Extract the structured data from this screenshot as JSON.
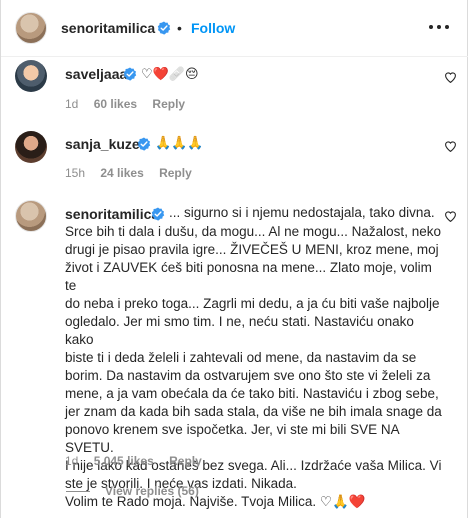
{
  "header": {
    "username": "senoritamilica",
    "separator": "•",
    "follow_label": "Follow"
  },
  "comments": [
    {
      "username": "saveljaaa",
      "text": "♡❤️🩹😔",
      "age": "1d",
      "likes": "60 likes",
      "reply_label": "Reply"
    },
    {
      "username": "sanja_kuzet",
      "text": "🙏🙏🙏",
      "age": "15h",
      "likes": "24 likes",
      "reply_label": "Reply"
    },
    {
      "username": "senoritamilica",
      "text_first": "... sigurno si i njemu nedostajala, tako divna.",
      "text_lines": [
        "Srce bih ti dala i dušu, da mogu... Al ne mogu... Nažalost, neko",
        "drugi je pisao pravila igre... ŽIVEČEŠ U MENI, kroz mene, moj",
        "život i ZAUVEK ćeš biti ponosna na mene... Zlato moje, volim te",
        "do neba i preko toga... Zagrli mi dedu, a ja ću biti vaše najbolje",
        "ogledalo. Jer mi smo tim. I ne, neću stati. Nastaviću onako kako",
        "biste ti i deda želeli i zahtevali od mene, da nastavim da se",
        "borim. Da nastavim da ostvarujem sve ono što ste vi želeli za",
        "mene, a ja vam obećala da će tako biti. Nastaviću i zbog sebe,",
        "jer znam da kada bih sada stala, da više ne bih imala snage da",
        "ponovo krenem sve ispočetka. Jer, vi ste mi bili SVE NA SVETU.",
        "I nije lako kad ostaneš bez svega. Ali... Izdržaće vaša Milica. Vi",
        "ste je stvorili. I neće vas izdati. Nikada.",
        "Volim te Rado moja. Najviše. Tvoja Milica. ♡🙏❤️"
      ],
      "age": "1d",
      "likes": "5,045 likes",
      "reply_label": "Reply"
    }
  ],
  "view_replies": "View replies (56)",
  "colors": {
    "accent": "#0095f6",
    "verified": "#3897f0",
    "secondary_text": "#8e8e8e"
  },
  "icons": [
    "verified-badge-icon",
    "more-options-icon",
    "heart-outline-icon"
  ]
}
